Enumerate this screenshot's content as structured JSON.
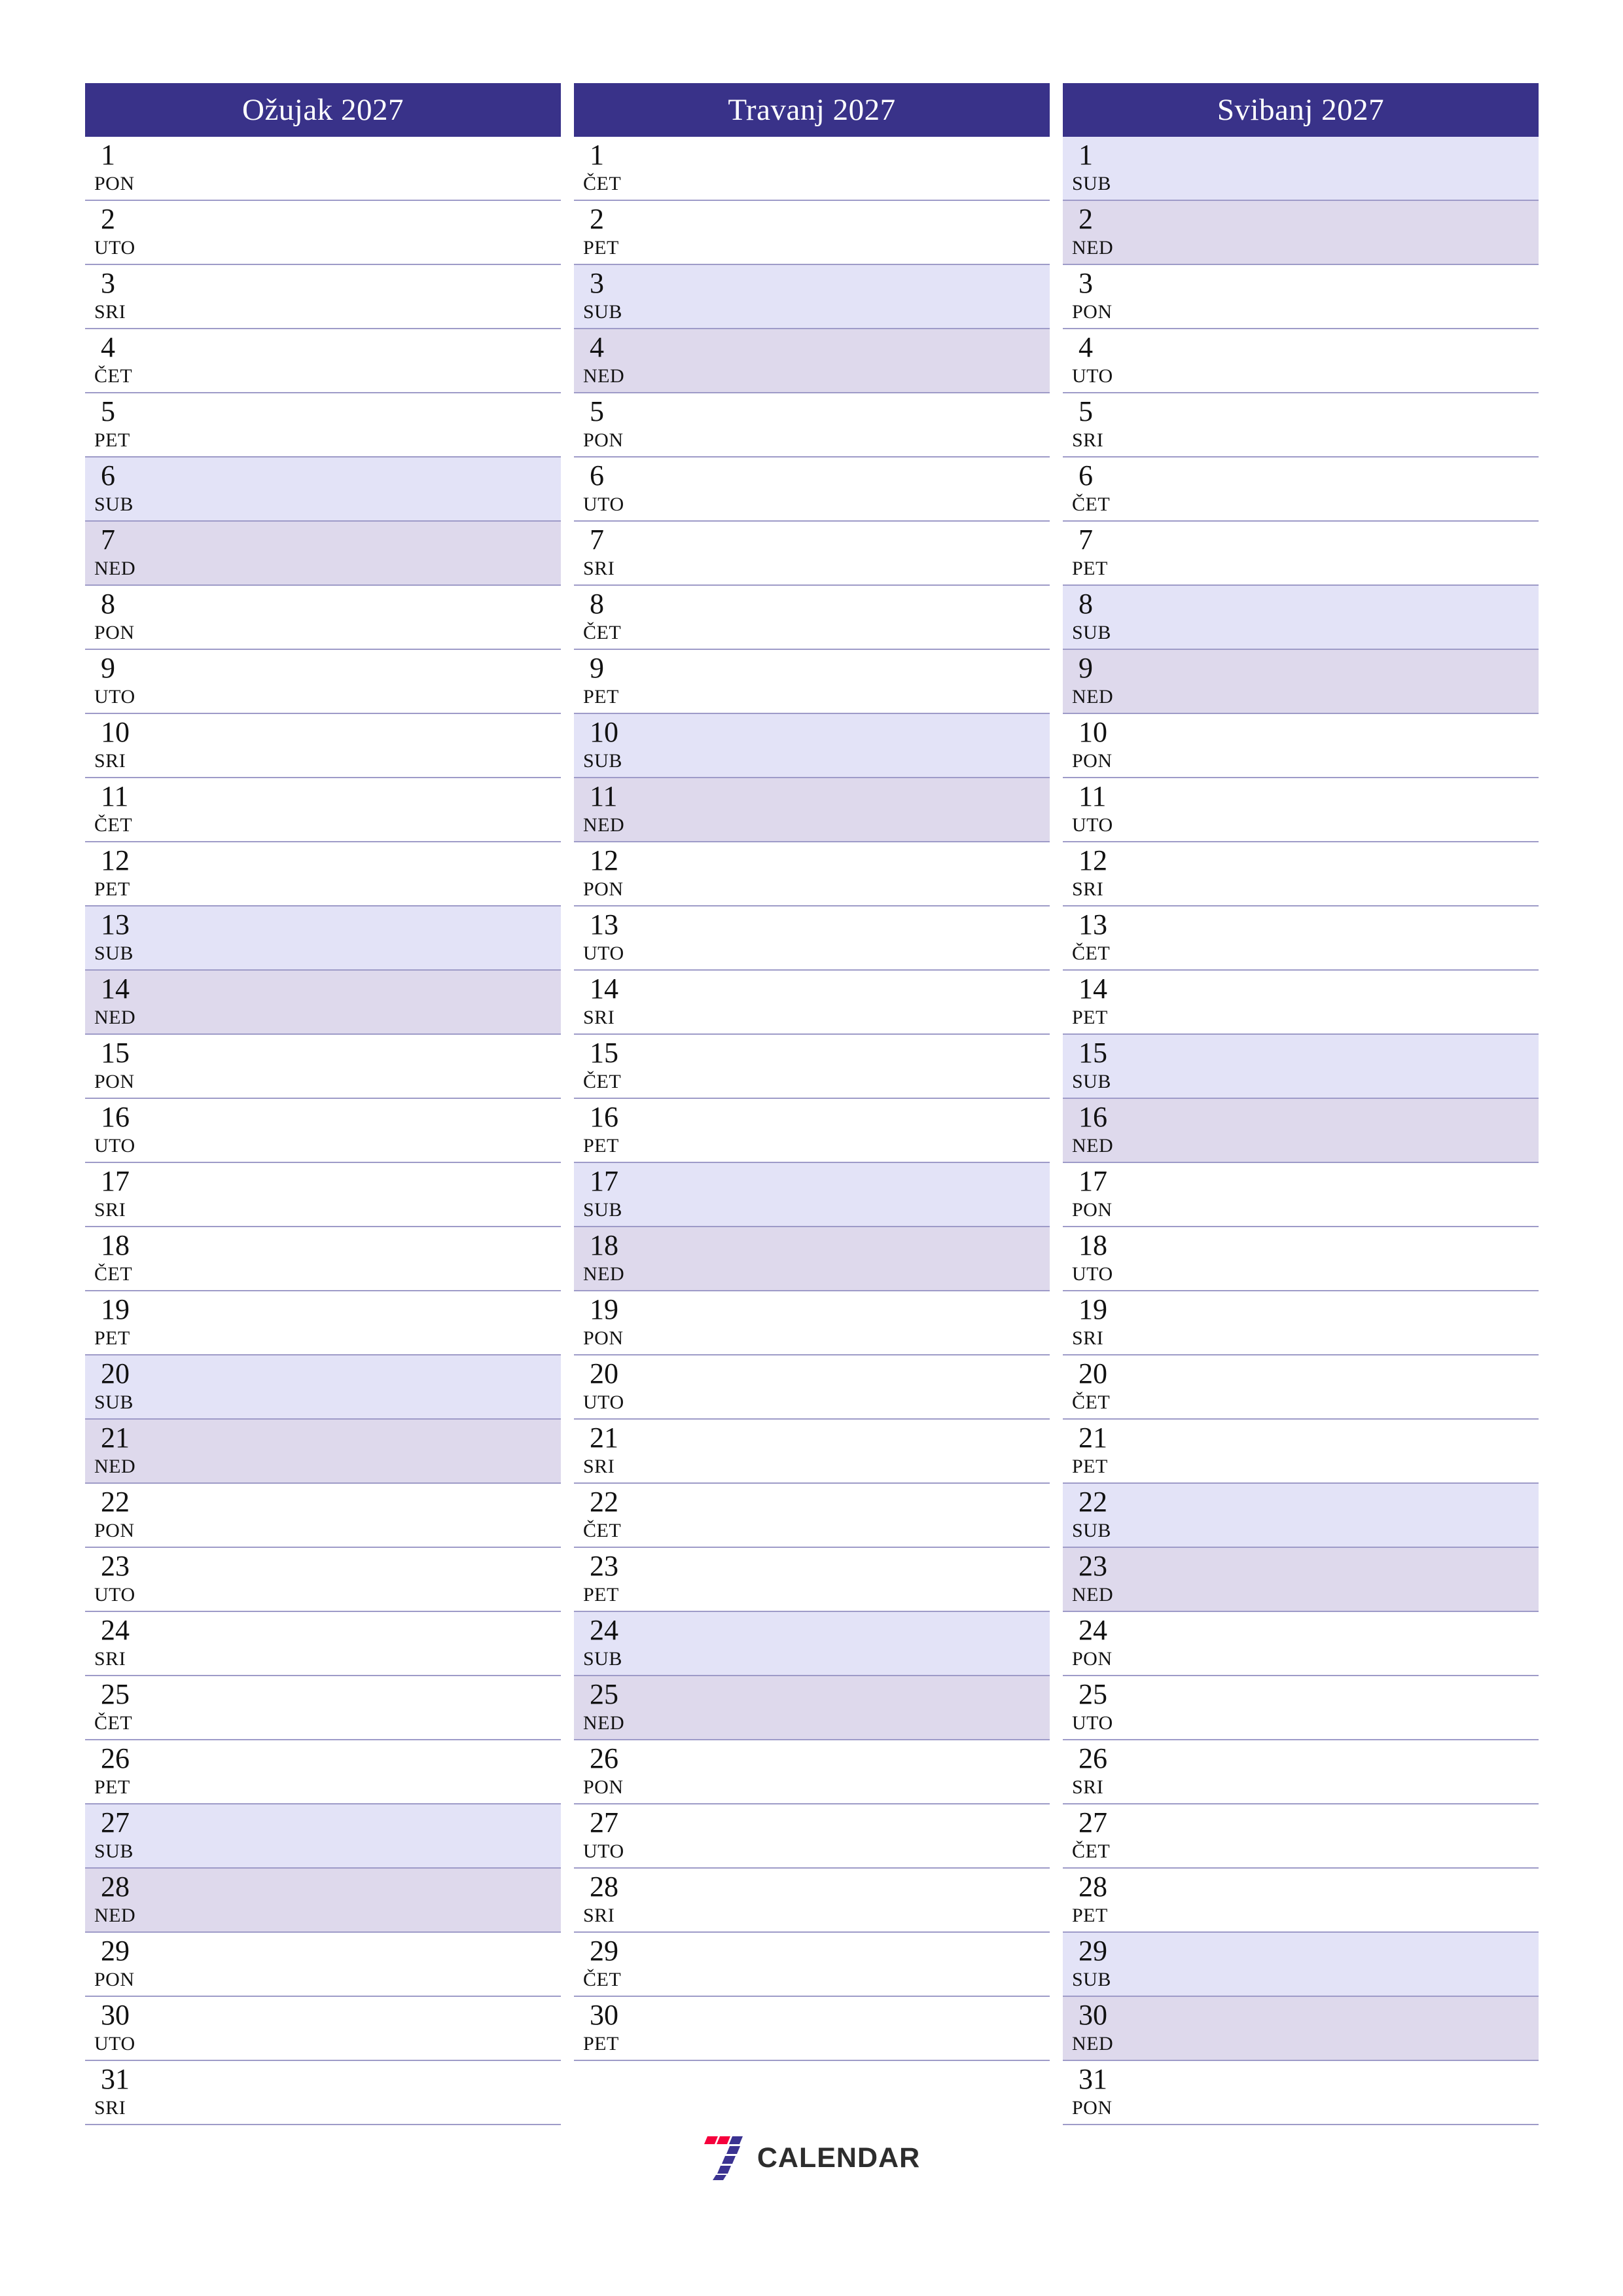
{
  "document": {
    "title": "Ožujak 2027 / Travanj 2027 / Svibanj 2027",
    "language": "hr",
    "year": "2027"
  },
  "colors": {
    "header_bg": "#393289",
    "header_text": "#ffffff",
    "row_border": "#9e9bc8",
    "saturday_bg": "#e3e3f7",
    "sunday_bg": "#ded9ec",
    "page_bg": "#ffffff",
    "logo_red": "#f5003c",
    "logo_indigo": "#3b3391",
    "logo_text": "#2d2d2d"
  },
  "brand": {
    "logo_mark_name": "seven-logo-icon",
    "logo_text": "CALENDAR"
  },
  "weekday_labels": {
    "mon": "PON",
    "tue": "UTO",
    "wed": "SRI",
    "thu": "ČET",
    "fri": "PET",
    "sat": "SUB",
    "sun": "NED"
  },
  "months": [
    {
      "title": "Ožujak 2027",
      "days": [
        {
          "num": "1",
          "name": "PON",
          "type": "weekday"
        },
        {
          "num": "2",
          "name": "UTO",
          "type": "weekday"
        },
        {
          "num": "3",
          "name": "SRI",
          "type": "weekday"
        },
        {
          "num": "4",
          "name": "ČET",
          "type": "weekday"
        },
        {
          "num": "5",
          "name": "PET",
          "type": "weekday"
        },
        {
          "num": "6",
          "name": "SUB",
          "type": "sat"
        },
        {
          "num": "7",
          "name": "NED",
          "type": "sun"
        },
        {
          "num": "8",
          "name": "PON",
          "type": "weekday"
        },
        {
          "num": "9",
          "name": "UTO",
          "type": "weekday"
        },
        {
          "num": "10",
          "name": "SRI",
          "type": "weekday"
        },
        {
          "num": "11",
          "name": "ČET",
          "type": "weekday"
        },
        {
          "num": "12",
          "name": "PET",
          "type": "weekday"
        },
        {
          "num": "13",
          "name": "SUB",
          "type": "sat"
        },
        {
          "num": "14",
          "name": "NED",
          "type": "sun"
        },
        {
          "num": "15",
          "name": "PON",
          "type": "weekday"
        },
        {
          "num": "16",
          "name": "UTO",
          "type": "weekday"
        },
        {
          "num": "17",
          "name": "SRI",
          "type": "weekday"
        },
        {
          "num": "18",
          "name": "ČET",
          "type": "weekday"
        },
        {
          "num": "19",
          "name": "PET",
          "type": "weekday"
        },
        {
          "num": "20",
          "name": "SUB",
          "type": "sat"
        },
        {
          "num": "21",
          "name": "NED",
          "type": "sun"
        },
        {
          "num": "22",
          "name": "PON",
          "type": "weekday"
        },
        {
          "num": "23",
          "name": "UTO",
          "type": "weekday"
        },
        {
          "num": "24",
          "name": "SRI",
          "type": "weekday"
        },
        {
          "num": "25",
          "name": "ČET",
          "type": "weekday"
        },
        {
          "num": "26",
          "name": "PET",
          "type": "weekday"
        },
        {
          "num": "27",
          "name": "SUB",
          "type": "sat"
        },
        {
          "num": "28",
          "name": "NED",
          "type": "sun"
        },
        {
          "num": "29",
          "name": "PON",
          "type": "weekday"
        },
        {
          "num": "30",
          "name": "UTO",
          "type": "weekday"
        },
        {
          "num": "31",
          "name": "SRI",
          "type": "weekday"
        }
      ]
    },
    {
      "title": "Travanj 2027",
      "days": [
        {
          "num": "1",
          "name": "ČET",
          "type": "weekday"
        },
        {
          "num": "2",
          "name": "PET",
          "type": "weekday"
        },
        {
          "num": "3",
          "name": "SUB",
          "type": "sat"
        },
        {
          "num": "4",
          "name": "NED",
          "type": "sun"
        },
        {
          "num": "5",
          "name": "PON",
          "type": "weekday"
        },
        {
          "num": "6",
          "name": "UTO",
          "type": "weekday"
        },
        {
          "num": "7",
          "name": "SRI",
          "type": "weekday"
        },
        {
          "num": "8",
          "name": "ČET",
          "type": "weekday"
        },
        {
          "num": "9",
          "name": "PET",
          "type": "weekday"
        },
        {
          "num": "10",
          "name": "SUB",
          "type": "sat"
        },
        {
          "num": "11",
          "name": "NED",
          "type": "sun"
        },
        {
          "num": "12",
          "name": "PON",
          "type": "weekday"
        },
        {
          "num": "13",
          "name": "UTO",
          "type": "weekday"
        },
        {
          "num": "14",
          "name": "SRI",
          "type": "weekday"
        },
        {
          "num": "15",
          "name": "ČET",
          "type": "weekday"
        },
        {
          "num": "16",
          "name": "PET",
          "type": "weekday"
        },
        {
          "num": "17",
          "name": "SUB",
          "type": "sat"
        },
        {
          "num": "18",
          "name": "NED",
          "type": "sun"
        },
        {
          "num": "19",
          "name": "PON",
          "type": "weekday"
        },
        {
          "num": "20",
          "name": "UTO",
          "type": "weekday"
        },
        {
          "num": "21",
          "name": "SRI",
          "type": "weekday"
        },
        {
          "num": "22",
          "name": "ČET",
          "type": "weekday"
        },
        {
          "num": "23",
          "name": "PET",
          "type": "weekday"
        },
        {
          "num": "24",
          "name": "SUB",
          "type": "sat"
        },
        {
          "num": "25",
          "name": "NED",
          "type": "sun"
        },
        {
          "num": "26",
          "name": "PON",
          "type": "weekday"
        },
        {
          "num": "27",
          "name": "UTO",
          "type": "weekday"
        },
        {
          "num": "28",
          "name": "SRI",
          "type": "weekday"
        },
        {
          "num": "29",
          "name": "ČET",
          "type": "weekday"
        },
        {
          "num": "30",
          "name": "PET",
          "type": "weekday"
        }
      ]
    },
    {
      "title": "Svibanj 2027",
      "days": [
        {
          "num": "1",
          "name": "SUB",
          "type": "sat"
        },
        {
          "num": "2",
          "name": "NED",
          "type": "sun"
        },
        {
          "num": "3",
          "name": "PON",
          "type": "weekday"
        },
        {
          "num": "4",
          "name": "UTO",
          "type": "weekday"
        },
        {
          "num": "5",
          "name": "SRI",
          "type": "weekday"
        },
        {
          "num": "6",
          "name": "ČET",
          "type": "weekday"
        },
        {
          "num": "7",
          "name": "PET",
          "type": "weekday"
        },
        {
          "num": "8",
          "name": "SUB",
          "type": "sat"
        },
        {
          "num": "9",
          "name": "NED",
          "type": "sun"
        },
        {
          "num": "10",
          "name": "PON",
          "type": "weekday"
        },
        {
          "num": "11",
          "name": "UTO",
          "type": "weekday"
        },
        {
          "num": "12",
          "name": "SRI",
          "type": "weekday"
        },
        {
          "num": "13",
          "name": "ČET",
          "type": "weekday"
        },
        {
          "num": "14",
          "name": "PET",
          "type": "weekday"
        },
        {
          "num": "15",
          "name": "SUB",
          "type": "sat"
        },
        {
          "num": "16",
          "name": "NED",
          "type": "sun"
        },
        {
          "num": "17",
          "name": "PON",
          "type": "weekday"
        },
        {
          "num": "18",
          "name": "UTO",
          "type": "weekday"
        },
        {
          "num": "19",
          "name": "SRI",
          "type": "weekday"
        },
        {
          "num": "20",
          "name": "ČET",
          "type": "weekday"
        },
        {
          "num": "21",
          "name": "PET",
          "type": "weekday"
        },
        {
          "num": "22",
          "name": "SUB",
          "type": "sat"
        },
        {
          "num": "23",
          "name": "NED",
          "type": "sun"
        },
        {
          "num": "24",
          "name": "PON",
          "type": "weekday"
        },
        {
          "num": "25",
          "name": "UTO",
          "type": "weekday"
        },
        {
          "num": "26",
          "name": "SRI",
          "type": "weekday"
        },
        {
          "num": "27",
          "name": "ČET",
          "type": "weekday"
        },
        {
          "num": "28",
          "name": "PET",
          "type": "weekday"
        },
        {
          "num": "29",
          "name": "SUB",
          "type": "sat"
        },
        {
          "num": "30",
          "name": "NED",
          "type": "sun"
        },
        {
          "num": "31",
          "name": "PON",
          "type": "weekday"
        }
      ]
    }
  ]
}
